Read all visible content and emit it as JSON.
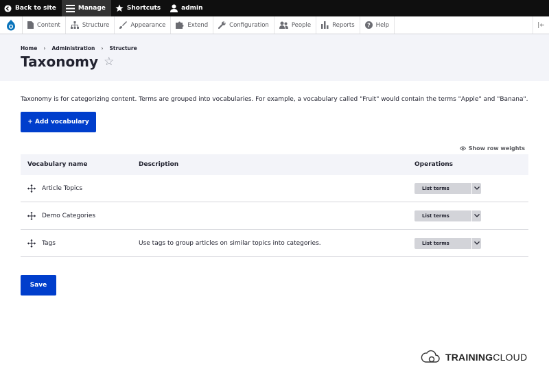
{
  "toolbar": {
    "back_to_site": "Back to site",
    "manage": "Manage",
    "shortcuts": "Shortcuts",
    "user": "admin"
  },
  "tray": {
    "items": [
      {
        "label": "Content",
        "icon": "document-icon"
      },
      {
        "label": "Structure",
        "icon": "sitemap-icon"
      },
      {
        "label": "Appearance",
        "icon": "paintbrush-icon"
      },
      {
        "label": "Extend",
        "icon": "puzzle-icon"
      },
      {
        "label": "Configuration",
        "icon": "wrench-icon"
      },
      {
        "label": "People",
        "icon": "people-icon"
      },
      {
        "label": "Reports",
        "icon": "bar-chart-icon"
      },
      {
        "label": "Help",
        "icon": "help-icon"
      }
    ]
  },
  "breadcrumb": [
    "Home",
    "Administration",
    "Structure"
  ],
  "page": {
    "title": "Taxonomy",
    "intro": "Taxonomy is for categorizing content. Terms are grouped into vocabularies. For example, a vocabulary called \"Fruit\" would contain the terms \"Apple\" and \"Banana\".",
    "add_vocabulary": "+ Add vocabulary",
    "show_row_weights": "Show row weights",
    "save": "Save"
  },
  "table": {
    "headers": [
      "Vocabulary name",
      "Description",
      "Operations"
    ],
    "rows": [
      {
        "name": "Article Topics",
        "description": "",
        "operation": "List terms"
      },
      {
        "name": "Demo Categories",
        "description": "",
        "operation": "List terms"
      },
      {
        "name": "Tags",
        "description": "Use tags to group articles on similar topics into categories.",
        "operation": "List terms"
      }
    ]
  },
  "brand": {
    "bold": "TRAINING",
    "light": "CLOUD"
  },
  "colors": {
    "primary": "#003ecc",
    "header_bg": "#f3f4f9",
    "toolbar_bg": "#0f0f0f"
  }
}
